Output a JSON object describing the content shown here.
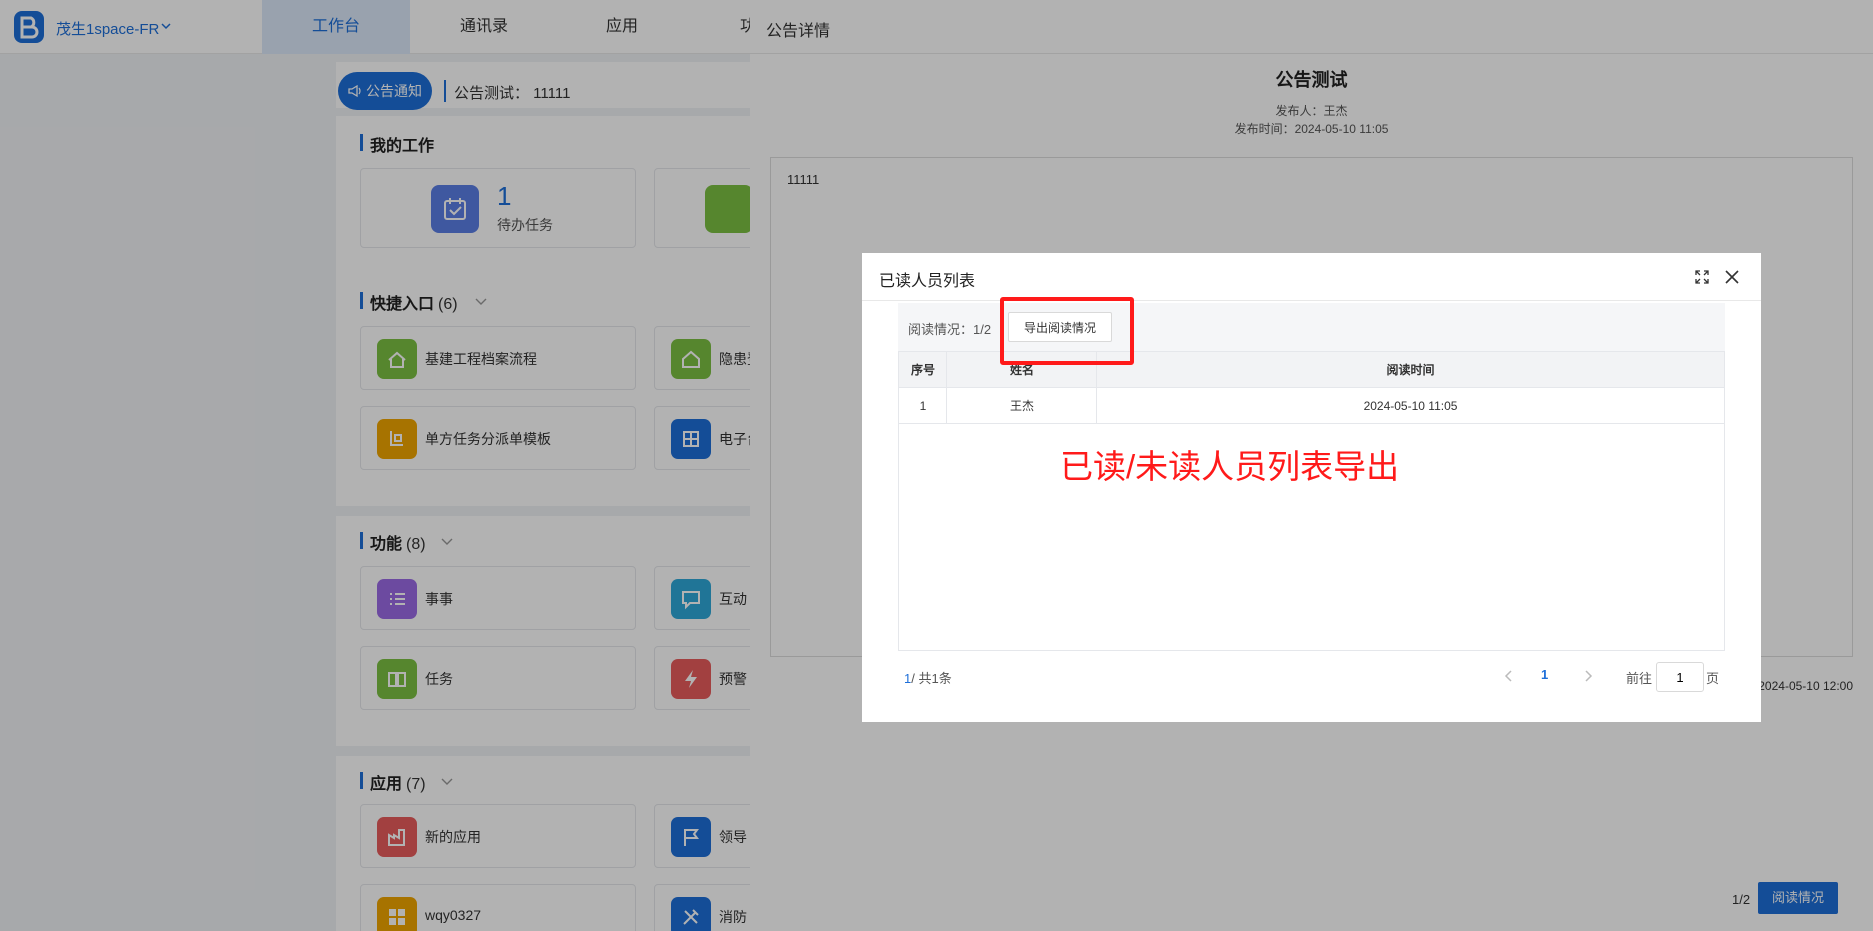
{
  "app": {
    "org_name": "茂生1space-FR",
    "nav": [
      "工作台",
      "通讯录",
      "应用",
      "功"
    ]
  },
  "notice": {
    "tag": "公告通知",
    "text": "公告测试：  11111"
  },
  "my_work": {
    "title": "我的工作",
    "todo_count": "1",
    "todo_label": "待办任务"
  },
  "quick": {
    "title": "快捷入口",
    "count": "(6)",
    "items": [
      {
        "label": "基建工程档案流程",
        "color": "#7cc043"
      },
      {
        "label": "隐患登",
        "color": "#7cc043"
      },
      {
        "label": "单方任务分派单模板",
        "color": "#f0a500"
      },
      {
        "label": "电子台",
        "color": "#1e6fd9"
      }
    ]
  },
  "func": {
    "title": "功能",
    "count": "(8)",
    "items": [
      {
        "label": "事事",
        "color": "#9b6be5"
      },
      {
        "label": "互动",
        "color": "#2fa8d8"
      },
      {
        "label": "任务",
        "color": "#7cc043"
      },
      {
        "label": "预警",
        "color": "#e85c5c"
      }
    ]
  },
  "apps": {
    "title": "应用",
    "count": "(7)",
    "items": [
      {
        "label": "新的应用",
        "color": "#e85c5c"
      },
      {
        "label": "领导",
        "color": "#1e6fd9"
      },
      {
        "label": "wqy0327",
        "color": "#f0a500"
      },
      {
        "label": "消防",
        "color": "#1e6fd9"
      }
    ]
  },
  "drawer": {
    "title": "公告详情",
    "ann_title": "公告测试",
    "publisher": "发布人：王杰",
    "publish_time": "发布时间：2024-05-10 11:05",
    "body": "11111",
    "end_time": "2024-05-10 12:00",
    "footer_ratio": "1/2",
    "footer_button": "阅读情况"
  },
  "modal": {
    "title": "已读人员列表",
    "read_status": "阅读情况：1/2",
    "export_button": "导出阅读情况",
    "columns": [
      "序号",
      "姓名",
      "阅读时间"
    ],
    "rows": [
      {
        "index": "1",
        "name": "王杰",
        "time": "2024-05-10 11:05"
      }
    ],
    "caption": "已读/未读人员列表导出",
    "pagination": {
      "current": "1",
      "total_text": "/ 共1条",
      "page": "1",
      "goto": "前往",
      "goto_value": "1",
      "page_suffix": "页"
    }
  },
  "colors": {
    "accent": "#1e6fd9",
    "highlight": "#ff1a1a"
  }
}
